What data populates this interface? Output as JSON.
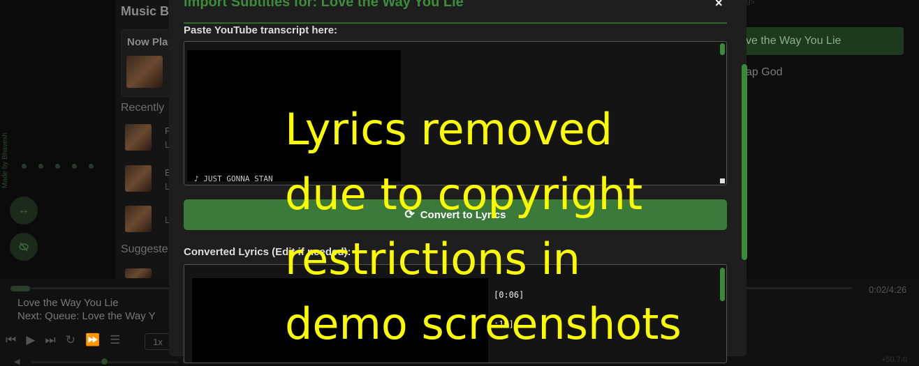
{
  "app": {
    "library_title": "Music B",
    "now_playing_label": "Now Pla",
    "recently_label": "Recently",
    "suggested_label": "Suggeste",
    "sidebar_vertical_text": "Made by Bhavesh",
    "recent_items": [
      {
        "line1": "F",
        "line2": "L"
      },
      {
        "line1": "E",
        "line2": "L"
      },
      {
        "line1": "",
        "line2": "L"
      }
    ]
  },
  "right_list": {
    "header_fragment": "gs",
    "items": [
      {
        "label": "ve the Way You Lie",
        "active": true
      },
      {
        "label": "ap God",
        "active": false
      }
    ]
  },
  "player": {
    "song_title": "Love the Way You Lie",
    "next_text": "Next: Queue: Love the Way Y",
    "time": "0:02/4:26",
    "playback_rate": "1x",
    "volume_readout": "0",
    "volume_right": "+50.7.0",
    "progress_fraction": 0.008
  },
  "modal": {
    "title": "Import Subtitles for: Love the Way You Lie",
    "close_glyph": "×",
    "transcript_label": "Paste YouTube transcript here:",
    "transcript_visible_text": "♪ JUST GONNA STAN",
    "convert_label": "Convert to Lyrics",
    "convert_icon": "⟳",
    "converted_label": "Converted Lyrics (Edit if needed):",
    "converted_lines": [
      "[0:06]",
      ":10]"
    ]
  },
  "overlay": {
    "lines": [
      "Lyrics removed",
      "due to copyright",
      "restrictions in",
      "demo screenshots"
    ]
  },
  "colors": {
    "accent": "#3c7a3c",
    "modal_title": "#3c8c3c",
    "overlay_text": "#fbfb00"
  }
}
